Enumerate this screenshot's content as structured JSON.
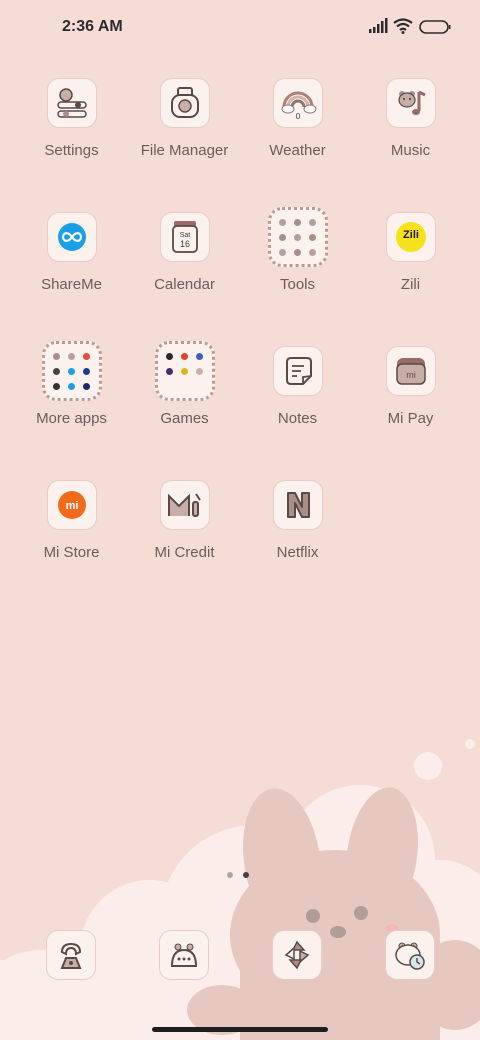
{
  "status": {
    "time": "2:36 AM"
  },
  "apps": [
    {
      "label": "Settings",
      "icon": "settings-icon"
    },
    {
      "label": "File Manager",
      "icon": "file-manager-icon"
    },
    {
      "label": "Weather",
      "icon": "weather-icon",
      "badge": "0"
    },
    {
      "label": "Music",
      "icon": "music-icon"
    },
    {
      "label": "ShareMe",
      "icon": "shareme-icon"
    },
    {
      "label": "Calendar",
      "icon": "calendar-icon",
      "day": "Sat",
      "date": "16"
    },
    {
      "label": "Tools",
      "icon": "tools-folder-icon"
    },
    {
      "label": "Zili",
      "icon": "zili-icon",
      "glyph": "Zili"
    },
    {
      "label": "More apps",
      "icon": "more-apps-folder-icon"
    },
    {
      "label": "Games",
      "icon": "games-folder-icon"
    },
    {
      "label": "Notes",
      "icon": "notes-icon"
    },
    {
      "label": "Mi Pay",
      "icon": "mi-pay-icon",
      "glyph": "mi"
    },
    {
      "label": "Mi Store",
      "icon": "mi-store-icon",
      "glyph": "mi"
    },
    {
      "label": "Mi Credit",
      "icon": "mi-credit-icon"
    },
    {
      "label": "Netflix",
      "icon": "netflix-icon"
    }
  ],
  "dock": [
    {
      "icon": "phone-icon"
    },
    {
      "icon": "messages-icon"
    },
    {
      "icon": "camera-icon"
    },
    {
      "icon": "browser-icon"
    }
  ],
  "pages": {
    "count": 2,
    "current": 2
  },
  "colors": {
    "background": "#f5dcd5",
    "icon_bg": "#fbf2ee",
    "label": "#6a5d5a",
    "accent_orange": "#f26a1b",
    "accent_blue": "#1b9ee8",
    "zili_yellow": "#f7e11b"
  }
}
